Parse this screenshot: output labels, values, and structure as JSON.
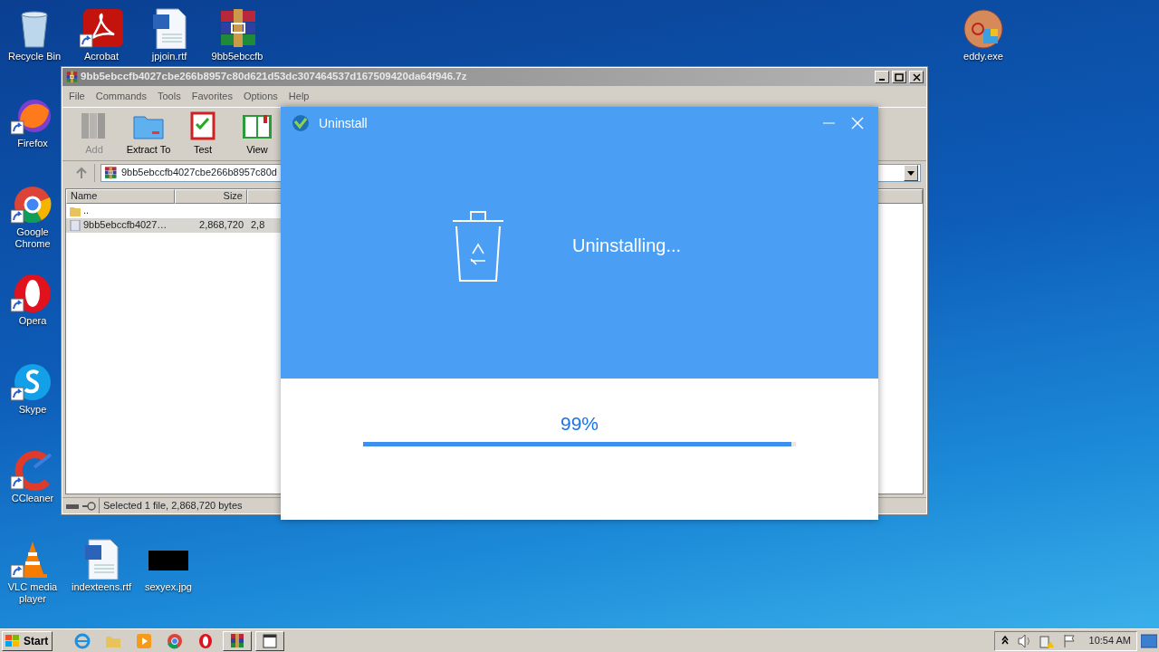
{
  "desktop_icons": [
    {
      "label": "Recycle Bin",
      "kind": "bin",
      "shortcut": false
    },
    {
      "label": "Acrobat",
      "kind": "pdf",
      "shortcut": true
    },
    {
      "label": "jpjoin.rtf",
      "kind": "doc",
      "shortcut": false
    },
    {
      "label": "9bb5ebccfb",
      "kind": "archive",
      "shortcut": false
    },
    {
      "label": "eddy.exe",
      "kind": "exe",
      "shortcut": false
    },
    {
      "label": "Firefox",
      "kind": "firefox",
      "shortcut": true
    },
    {
      "label": "Google Chrome",
      "kind": "chrome",
      "shortcut": true
    },
    {
      "label": "Opera",
      "kind": "opera",
      "shortcut": true
    },
    {
      "label": "Skype",
      "kind": "skype",
      "shortcut": true
    },
    {
      "label": "CCleaner",
      "kind": "ccleaner",
      "shortcut": true
    },
    {
      "label": "VLC media player",
      "kind": "vlc",
      "shortcut": true
    },
    {
      "label": "indexteens.rtf",
      "kind": "doc",
      "shortcut": false
    },
    {
      "label": "sexyex.jpg",
      "kind": "image",
      "shortcut": false
    }
  ],
  "archive_window": {
    "title": "9bb5ebccfb4027cbe266b8957c80d621d53dc307464537d167509420da64f946.7z",
    "menu": [
      "File",
      "Commands",
      "Tools",
      "Favorites",
      "Options",
      "Help"
    ],
    "toolbar": [
      {
        "label": "Add",
        "kind": "add",
        "disabled": true
      },
      {
        "label": "Extract To",
        "kind": "extract",
        "disabled": false
      },
      {
        "label": "Test",
        "kind": "test",
        "disabled": false
      },
      {
        "label": "View",
        "kind": "view",
        "disabled": false
      }
    ],
    "path": "9bb5ebccfb4027cbe266b8957c80d",
    "columns": [
      "Name",
      "Size"
    ],
    "rows": [
      {
        "kind": "folder",
        "name": "..",
        "selected": false
      },
      {
        "kind": "file",
        "name": "9bb5ebccfb4027…",
        "size": "2,868,720",
        "column_3": "2,8",
        "selected": true
      }
    ],
    "status_bar": "Selected 1 file, 2,868,720 bytes"
  },
  "uninstall_dialog": {
    "title": "Uninstall",
    "message": "Uninstalling...",
    "percent": "99%",
    "level": 0.99
  },
  "taskbar": {
    "start": "Start",
    "apps": [
      {
        "kind": "ie",
        "active": false
      },
      {
        "kind": "explorer",
        "active": false
      },
      {
        "kind": "media",
        "active": false
      },
      {
        "kind": "chrome",
        "active": false
      },
      {
        "kind": "opera",
        "active": false
      },
      {
        "kind": "archive",
        "active": true
      },
      {
        "kind": "window",
        "active": true
      }
    ],
    "clock": "10:54 AM"
  }
}
